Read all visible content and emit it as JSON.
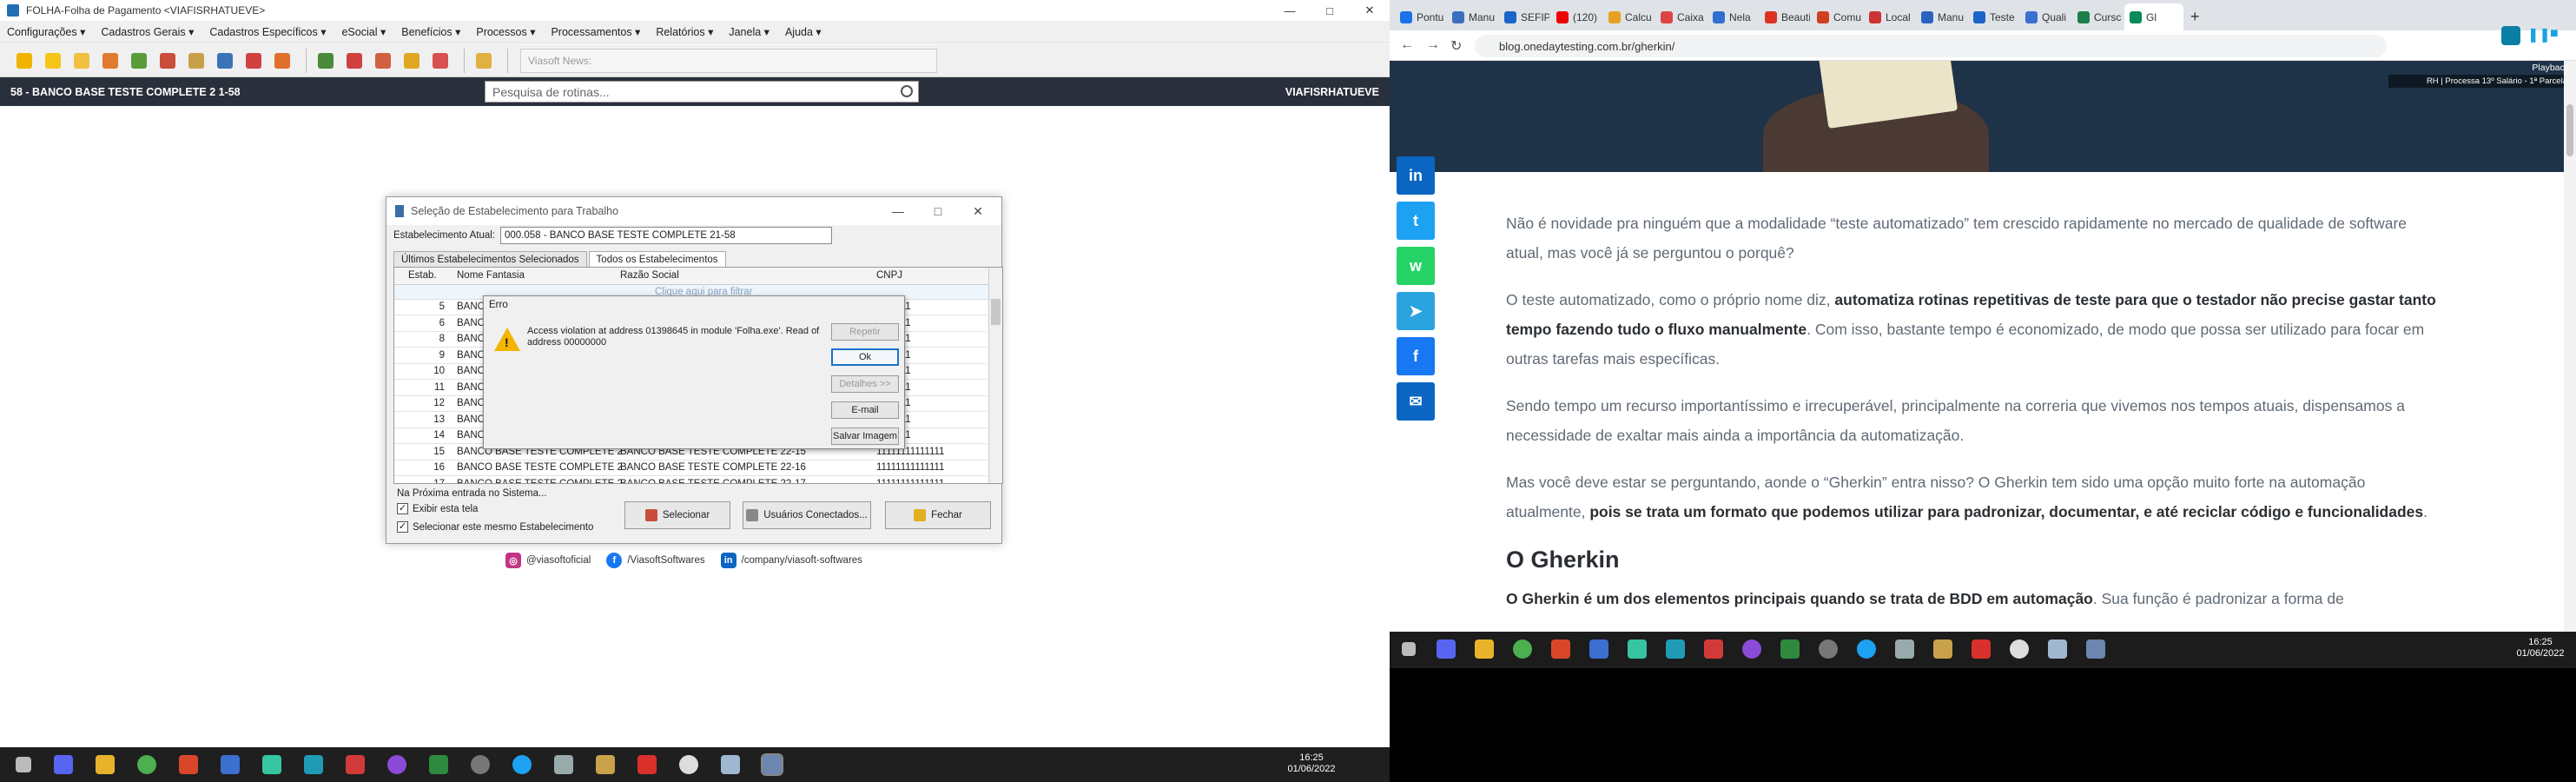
{
  "left_app": {
    "window_title": "FOLHA-Folha de Pagamento <VIAFISRHATUEVE>",
    "window_controls": [
      "—",
      "□",
      "✕"
    ],
    "menu": [
      "Configurações",
      "Cadastros Gerais",
      "Cadastros Específicos",
      "eSocial",
      "Benefícios",
      "Processos",
      "Processamentos",
      "Relatórios",
      "Janela",
      "Ajuda"
    ],
    "news_placeholder": "Viasoft News:",
    "status_left": "58 - BANCO BASE TESTE COMPLETE 2 1-58",
    "routine_search_placeholder": "Pesquisa de rotinas...",
    "status_right": "VIAFISRHATUEVE"
  },
  "dialog": {
    "title": "Seleção de Estabelecimento para Trabalho",
    "current_label": "Estabelecimento Atual:",
    "current_value": "000.058 - BANCO BASE TESTE COMPLETE 21-58",
    "tabs": [
      "Últimos Estabelecimentos Selecionados",
      "Todos os Estabelecimentos"
    ],
    "columns": [
      "Estab.",
      "Nome Fantasia",
      "Razão Social",
      "CNPJ"
    ],
    "filter_hint": "Clique aqui para filtrar",
    "rows": [
      {
        "estab": "5",
        "nome": "BANCO",
        "razao": "",
        "cnpj": "1111111"
      },
      {
        "estab": "6",
        "nome": "BANCO",
        "razao": "",
        "cnpj": "1111111"
      },
      {
        "estab": "8",
        "nome": "BANCO",
        "razao": "",
        "cnpj": "1111111"
      },
      {
        "estab": "9",
        "nome": "BANCO",
        "razao": "",
        "cnpj": "1111111"
      },
      {
        "estab": "10",
        "nome": "BANCO",
        "razao": "",
        "cnpj": "1111111"
      },
      {
        "estab": "11",
        "nome": "BANCO",
        "razao": "",
        "cnpj": "1111111"
      },
      {
        "estab": "12",
        "nome": "BANCO",
        "razao": "",
        "cnpj": "1111111"
      },
      {
        "estab": "13",
        "nome": "BANCO",
        "razao": "",
        "cnpj": "1111111"
      },
      {
        "estab": "14",
        "nome": "BANCO",
        "razao": "",
        "cnpj": "1111111"
      },
      {
        "estab": "15",
        "nome": "BANCO BASE TESTE COMPLETE 2",
        "razao": "BANCO BASE TESTE COMPLETE 22-15",
        "cnpj": "11111111111111"
      },
      {
        "estab": "16",
        "nome": "BANCO BASE TESTE COMPLETE 2",
        "razao": "BANCO BASE TESTE COMPLETE 22-16",
        "cnpj": "11111111111111"
      },
      {
        "estab": "17",
        "nome": "BANCO BASE TESTE COMPLETE 2",
        "razao": "BANCO BASE TESTE COMPLETE 22-17",
        "cnpj": "11111111111111"
      }
    ],
    "next_entry_label": "Na Próxima entrada no Sistema...",
    "chk_show": "Exibir esta tela",
    "chk_same": "Selecionar este mesmo Estabelecimento",
    "btn_select": "Selecionar",
    "btn_users": "Usuários Conectados...",
    "btn_close": "Fechar"
  },
  "error": {
    "title": "Erro",
    "message": "Access violation at address 01398645 in module 'Folha.exe'. Read of address 00000000",
    "btn_repeat": "Repetir",
    "btn_ok": "Ok",
    "btn_details": "Detalhes >>",
    "btn_email": "E-mail",
    "btn_save_image": "Salvar Imagem"
  },
  "social": [
    {
      "icon": "instagram-icon",
      "label": "@viasoftoficial",
      "color": "#c13584"
    },
    {
      "icon": "facebook-icon",
      "label": "/ViasoftSoftwares",
      "color": "#1877f2"
    },
    {
      "icon": "linkedin-icon",
      "label": "/company/viasoft-softwares",
      "color": "#0a66c2"
    }
  ],
  "taskbar_left": {
    "time": "16:25",
    "date": "01/06/2022"
  },
  "browser": {
    "tabs": [
      "Pontu",
      "Manu",
      "SEFIP",
      "(120)",
      "Calcu",
      "Caixa",
      "Nela",
      "Beauti",
      "Comu",
      "Local",
      "Manu",
      "Teste",
      "Quali",
      "Cursc",
      "Gl"
    ],
    "url": "blog.onedaytesting.com.br/gherkin/",
    "playback_label": "Playback",
    "playback_sub": "RH | Processa 13º Salário - 1ª Parcela",
    "share": [
      {
        "name": "linkedin-share",
        "glyph": "in",
        "color": "#0a66c2"
      },
      {
        "name": "twitter-share",
        "glyph": "t",
        "color": "#1da1f2"
      },
      {
        "name": "whatsapp-share",
        "glyph": "w",
        "color": "#25d366"
      },
      {
        "name": "telegram-share",
        "glyph": "➤",
        "color": "#2aa3df"
      },
      {
        "name": "facebook-share",
        "glyph": "f",
        "color": "#1877f2"
      },
      {
        "name": "email-share",
        "glyph": "✉",
        "color": "#0a66c2"
      }
    ],
    "article": {
      "p1": "Não é novidade pra ninguém que a modalidade “teste automatizado” tem crescido rapidamente no mercado de qualidade de software atual, mas você já se perguntou o porquê?",
      "p2_pre": "O teste automatizado, como o próprio nome diz, ",
      "p2_bold": "automatiza rotinas repetitivas de teste para que o testador não precise gastar tanto tempo fazendo tudo o fluxo manualmente",
      "p2_post": ". Com isso, bastante tempo é economizado, de modo que possa ser utilizado para focar em outras tarefas mais específicas.",
      "p3": "Sendo tempo um recurso importantíssimo e irrecuperável, principalmente na correria que vivemos nos tempos atuais, dispensamos a necessidade de exaltar mais ainda a importância da automatização.",
      "p4_pre": "Mas você deve estar se perguntando, aonde o “Gherkin” entra nisso? O Gherkin tem sido uma opção muito forte na automação atualmente, ",
      "p4_bold": "pois se trata um formato que podemos utilizar para padronizar, documentar, e até reciclar código e funcionalidades",
      "p4_post": ".",
      "h2": "O Gherkin",
      "p5_bold": "O Gherkin é um dos elementos principais quando se trata de BDD em automação",
      "p5_post": ". Sua função é padronizar a forma de"
    }
  },
  "taskbar_right": {
    "time": "16:25",
    "date": "01/06/2022"
  }
}
